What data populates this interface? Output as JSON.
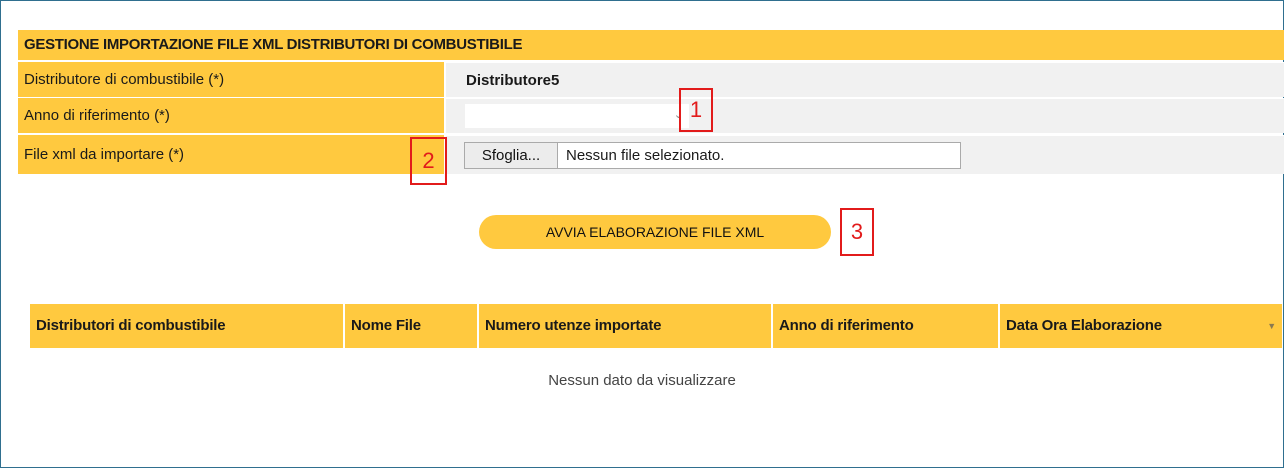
{
  "form": {
    "title": "GESTIONE IMPORTAZIONE FILE XML DISTRIBUTORI DI COMBUSTIBILE",
    "distributor_label": "Distributore di combustibile (*)",
    "distributor_value": "Distributore5",
    "year_label": "Anno di riferimento (*)",
    "year_value": "",
    "file_label": "File xml da importare (*)",
    "browse_label": "Sfoglia...",
    "file_status": "Nessun file selezionato."
  },
  "callouts": [
    "1",
    "2",
    "3"
  ],
  "actions": {
    "run_label": "AVVIA ELABORAZIONE FILE XML"
  },
  "grid": {
    "columns": [
      "Distributori di combustibile",
      "Nome File",
      "Numero utenze importate",
      "Anno di riferimento",
      "Data Ora Elaborazione"
    ],
    "empty_message": "Nessun dato da visualizzare"
  },
  "colors": {
    "accent": "#ffc93f",
    "callout": "#e21b1b",
    "value_bg": "#f1f1f1"
  },
  "icons": {
    "select_arrow": "chevron-down-icon",
    "sort": "sort-down-icon"
  }
}
